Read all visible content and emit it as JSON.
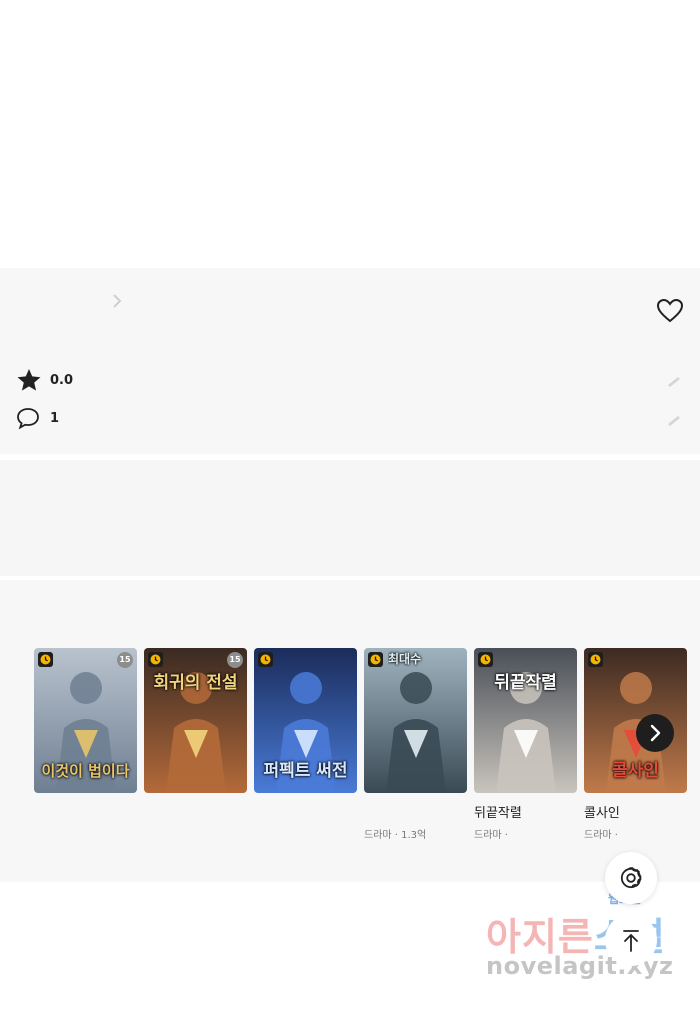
{
  "work": {
    "rating": "0.0",
    "comments": "1"
  },
  "recommendations": [
    {
      "title": "",
      "meta": "",
      "age": "15",
      "colors": [
        "#b9c3ce",
        "#6f7f92",
        "#e8c46a"
      ],
      "caption": "이것이 법이다"
    },
    {
      "title": "",
      "meta": "",
      "age": "15",
      "colors": [
        "#3a2a22",
        "#b46a3a",
        "#f3d47c"
      ],
      "caption": "회귀의 전설"
    },
    {
      "title": "",
      "meta": "",
      "age": "",
      "colors": [
        "#1b2c5a",
        "#4a7bd8",
        "#d8e8ff"
      ],
      "caption": "퍼펙트 써전"
    },
    {
      "title": "",
      "meta": "드라마 · 1.3억",
      "age": "",
      "colors": [
        "#9fb3bf",
        "#3a4a55",
        "#e0eef3"
      ],
      "caption": "최대수"
    },
    {
      "title": "뒤끝작렬",
      "meta": "드라마 ·",
      "age": "",
      "colors": [
        "#4a4f57",
        "#c9c4bd",
        "#ffffff"
      ],
      "caption": "뒤끝작렬"
    },
    {
      "title": "콜사인",
      "meta": "드라마 ·",
      "age": "",
      "colors": [
        "#3c2a22",
        "#c07a4a",
        "#e64a3a"
      ],
      "caption": "콜사인"
    }
  ],
  "icons": {
    "rating": "star-icon",
    "comments": "comment-icon",
    "favorite": "heart-icon",
    "next": "chevron-right-icon",
    "settings": "gear-icon",
    "scroll_top": "arrow-up-icon"
  },
  "watermark": {
    "main_left": "아지른",
    "main_right": "소설",
    "small": "웹소설",
    "domain": "novelagit.xyz"
  }
}
